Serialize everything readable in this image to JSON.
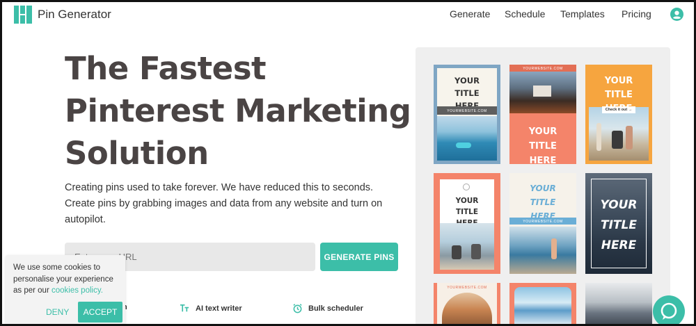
{
  "nav": {
    "brand": "Pin Generator",
    "links": [
      "Generate",
      "Schedule",
      "Templates",
      "Pricing"
    ],
    "user_icon": "user-circle-icon"
  },
  "hero": {
    "title_lines": [
      "The Fastest",
      "Pinterest Marketing",
      "Solution"
    ],
    "description": "Creating pins used to take forever. We have reduced this to seconds. Create pins by grabbing images and data from any website and turn on autopilot.",
    "url_placeholder": "Enter your URL",
    "generate_button": "GENERATE PINS"
  },
  "features": [
    {
      "label": "n",
      "icon": "image-icon"
    },
    {
      "label": "AI text writer",
      "icon": "text-tt-icon"
    },
    {
      "label": "Bulk scheduler",
      "icon": "alarm-clock-icon"
    }
  ],
  "pins": [
    {
      "title": "YOUR TITLE HERE",
      "site": "YOURWEBSITE.COM"
    },
    {
      "title": "YOUR TITLE HERE",
      "site": "YOURWEBSITE.COM"
    },
    {
      "title": "YOUR TITLE HERE",
      "cta": "Check it out →"
    },
    {
      "title": "YOUR TITLE HERE"
    },
    {
      "title": "YOUR TITLE HERE",
      "site": "YOURWEBSITE.COM"
    },
    {
      "title": "YOUR TITLE HERE"
    },
    {
      "site": "YOURWEBSITE.COM"
    },
    {},
    {}
  ],
  "cookie": {
    "text_before": "We use some cookies to personalise your experience as per our ",
    "link": "cookies policy.",
    "deny": "DENY",
    "accept": "ACCEPT"
  },
  "colors": {
    "accent": "#3cbea8",
    "title": "#4a4444",
    "coral": "#f4846a",
    "orange": "#f6a53f",
    "navy": "#2d3c4e"
  },
  "chat_icon": "chat-bubble-icon"
}
